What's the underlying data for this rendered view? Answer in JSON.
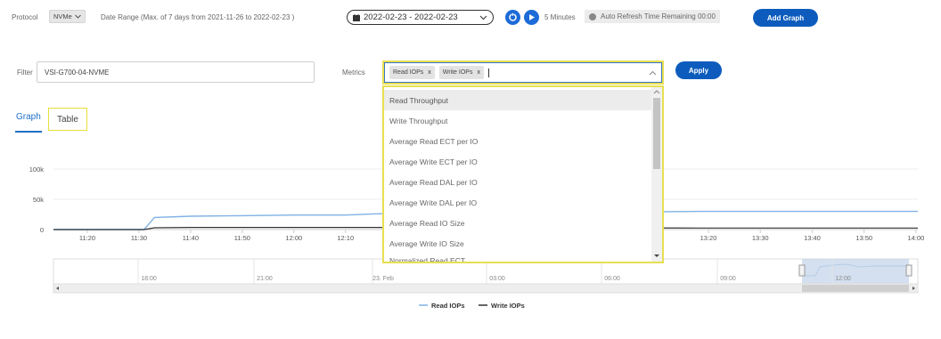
{
  "toolbar": {
    "protocol_label": "Protocol",
    "protocol_value": "NVMe",
    "date_range_label": "Date Range (Max. of 7 days from 2021-11-26 to 2022-02-23 )",
    "date_range_value": "2022-02-23 - 2022-02-23",
    "interval_label": "5 Minutes",
    "refresh_label": "Auto Refresh Time Remaining 00:00",
    "add_graph_label": "Add Graph"
  },
  "filter": {
    "label": "Filter",
    "value": "VSI-G700-04-NVME"
  },
  "metrics": {
    "label": "Metrics",
    "chips": [
      "Read IOPs",
      "Write IOPs"
    ],
    "chip_remove": "x",
    "apply_label": "Apply",
    "options": [
      "Read Throughput",
      "Write Throughput",
      "Average Read ECT per IO",
      "Average Write ECT per IO",
      "Average Read DAL per IO",
      "Average Write DAL per IO",
      "Average Read IO Size",
      "Average Write IO Size",
      "Normalized Read ECT"
    ]
  },
  "tabs": {
    "graph": "Graph",
    "table": "Table"
  },
  "colors": {
    "accent": "#1f6fc8",
    "highlight": "#e7df52",
    "read_series": "#7fb2e5",
    "write_series": "#333333"
  },
  "chart_data": {
    "type": "line",
    "y_ticks": [
      "100k",
      "50k",
      "0"
    ],
    "ylim": [
      0,
      100000
    ],
    "x_ticks": [
      "11:20",
      "11:30",
      "11:40",
      "11:50",
      "12:00",
      "12:10",
      "13:20",
      "13:30",
      "13:40",
      "13:50",
      "14:00"
    ],
    "series": [
      {
        "name": "Read IOPs",
        "color": "#7fb2e5",
        "x": [
          "11:15",
          "11:31",
          "11:33",
          "11:40",
          "11:50",
          "12:00",
          "12:10",
          "12:16",
          "13:15",
          "14:03"
        ],
        "values": [
          0,
          0,
          20000,
          22000,
          23000,
          24000,
          24000,
          26000,
          30000,
          30000
        ]
      },
      {
        "name": "Write IOPs",
        "color": "#333333",
        "x": [
          "11:15",
          "11:31",
          "11:33",
          "11:40",
          "11:50",
          "12:00",
          "12:10",
          "12:16",
          "13:15",
          "14:03"
        ],
        "values": [
          0,
          0,
          3000,
          3500,
          3500,
          3500,
          3500,
          3500,
          2500,
          2500
        ]
      }
    ],
    "navigator_ticks": [
      "18:00",
      "21:00",
      "23. Feb",
      "03:00",
      "06:00",
      "09:00",
      "12:00"
    ],
    "legend": [
      "Read IOPs",
      "Write IOPs"
    ],
    "legend_position": "bottom-center"
  }
}
